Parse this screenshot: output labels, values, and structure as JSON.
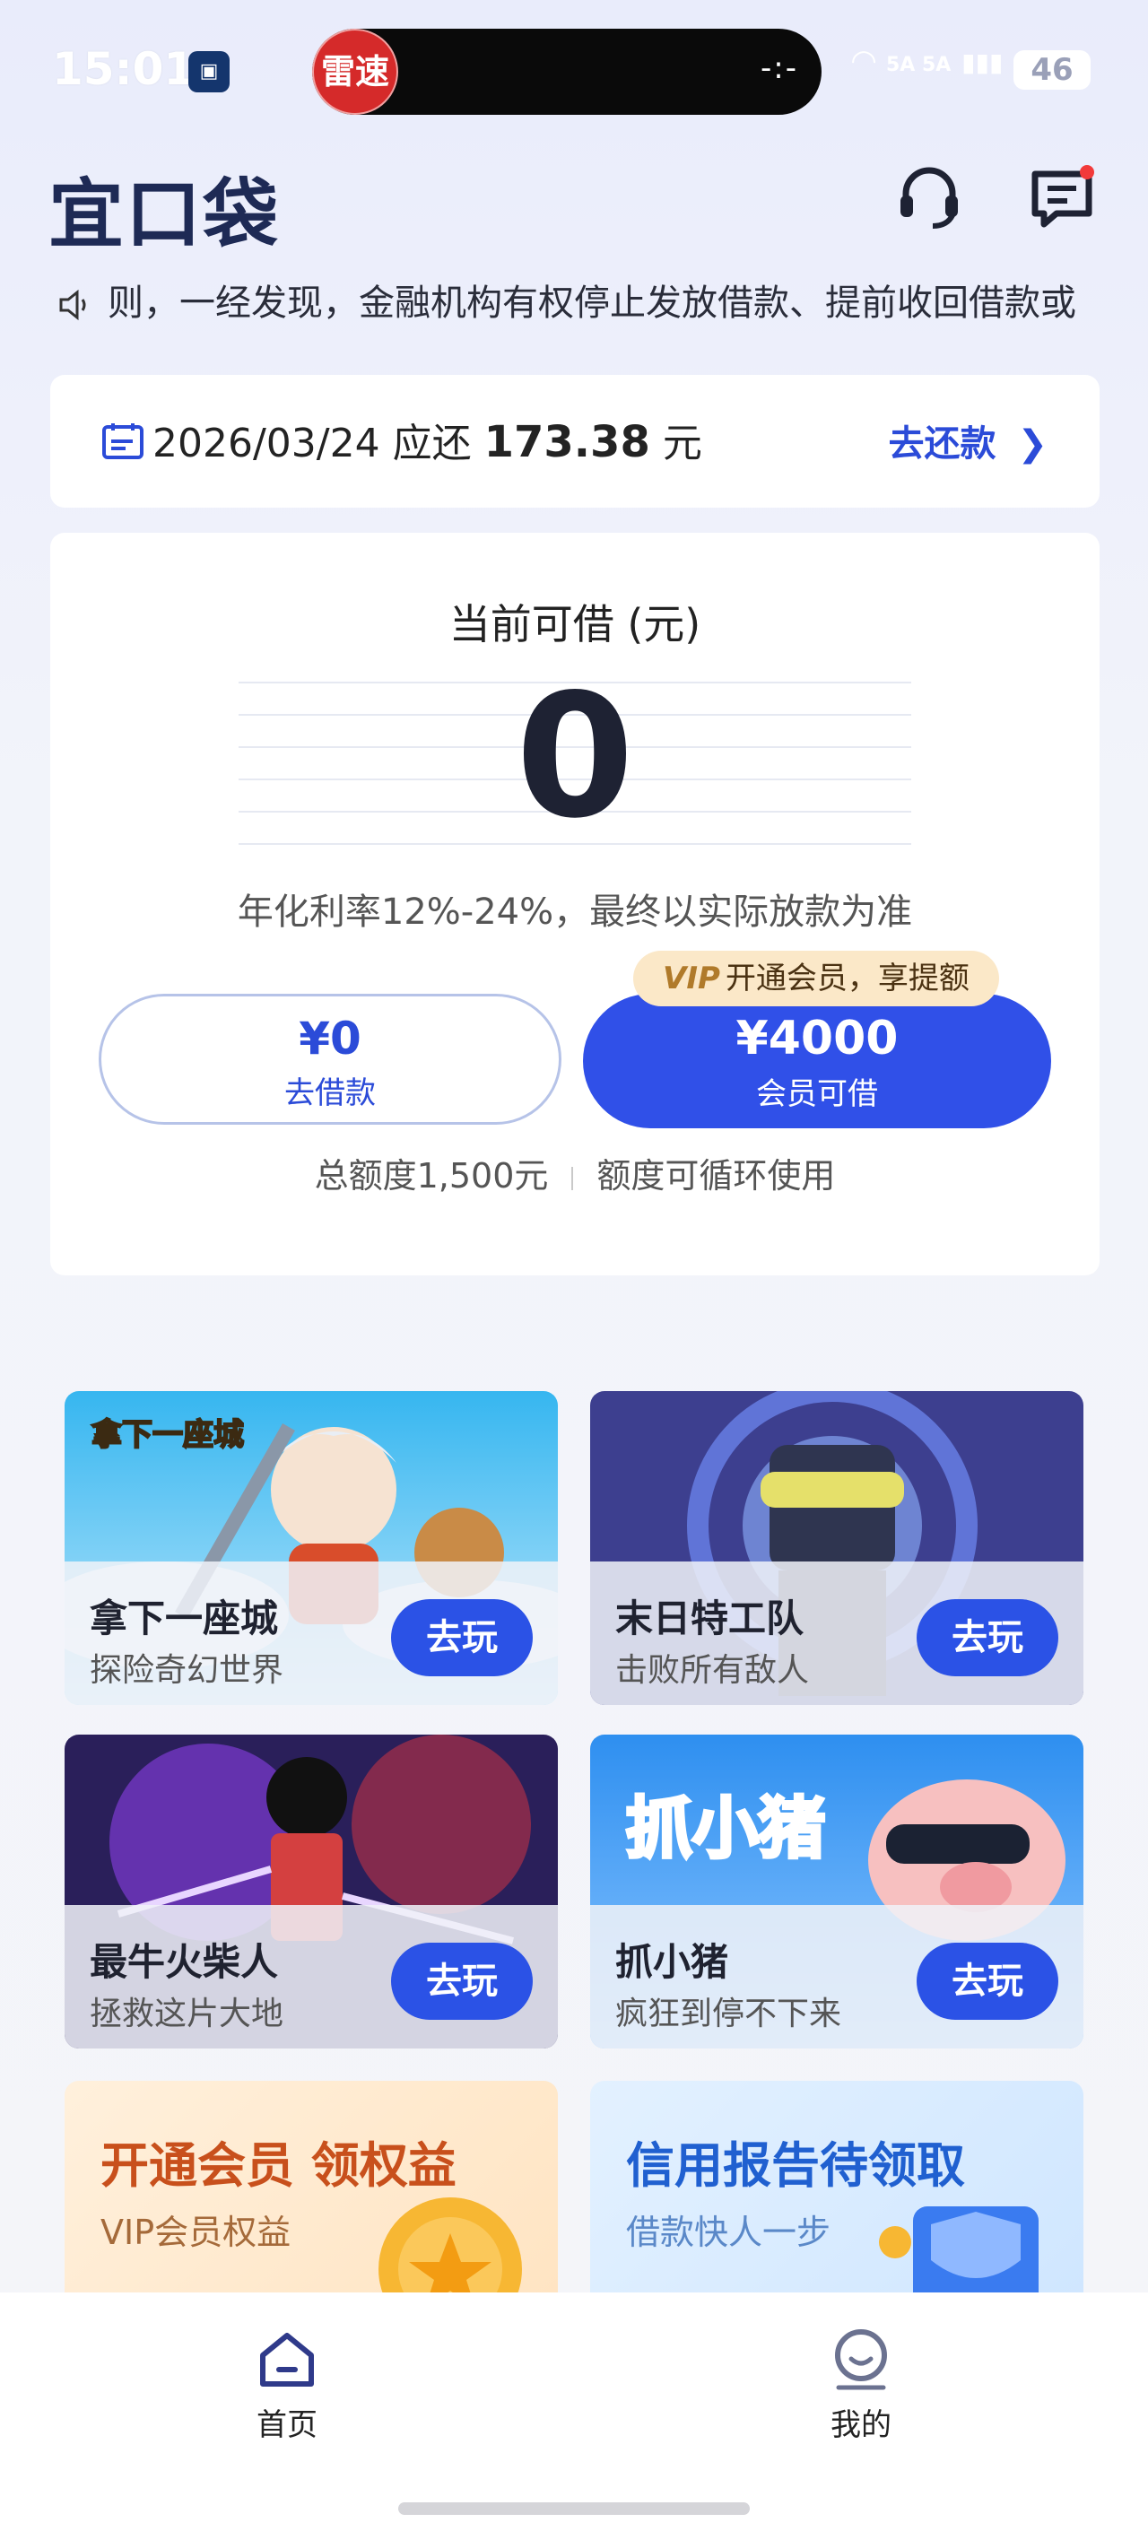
{
  "status_bar": {
    "time": "15:01",
    "island_badge": "雷速",
    "island_right": "-:-",
    "signal": "5A 5A",
    "battery": "46"
  },
  "header": {
    "logo": "宜口袋",
    "notice": "则，一经发现，金融机构有权停止发放借款、提前收回借款或"
  },
  "due": {
    "date": "2026/03/24",
    "prefix": "应还",
    "amount": "173.38",
    "unit": "元",
    "link": "去还款"
  },
  "borrow": {
    "label": "当前可借 (元)",
    "amount": "0",
    "rate": "年化利率12%-24%，最终以实际放款为准",
    "left_amount": "¥0",
    "left_label": "去借款",
    "vip_tag": "VIP",
    "vip_tip": "开通会员，享提额",
    "right_amount": "¥4000",
    "right_label": "会员可借",
    "total": "总额度1,500元",
    "cycle": "额度可循环使用"
  },
  "games": [
    {
      "name": "拿下一座城",
      "desc": "探险奇幻世界",
      "button": "去玩",
      "art_title": "拿下一座城"
    },
    {
      "name": "末日特工队",
      "desc": "击败所有敌人",
      "button": "去玩"
    },
    {
      "name": "最牛火柴人",
      "desc": "拯救这片大地",
      "button": "去玩"
    },
    {
      "name": "抓小猪",
      "desc": "疯狂到停不下来",
      "button": "去玩",
      "art_title": "抓小猪"
    }
  ],
  "promos": [
    {
      "title": "开通会员 领权益",
      "sub": "VIP会员权益"
    },
    {
      "title": "信用报告待领取",
      "sub": "借款快人一步"
    }
  ],
  "nav": {
    "home": "首页",
    "mine": "我的"
  },
  "colors": {
    "accent": "#2b4bd8",
    "primary_button": "#3050e8",
    "vip_tip_bg": "#fbe8c8"
  }
}
